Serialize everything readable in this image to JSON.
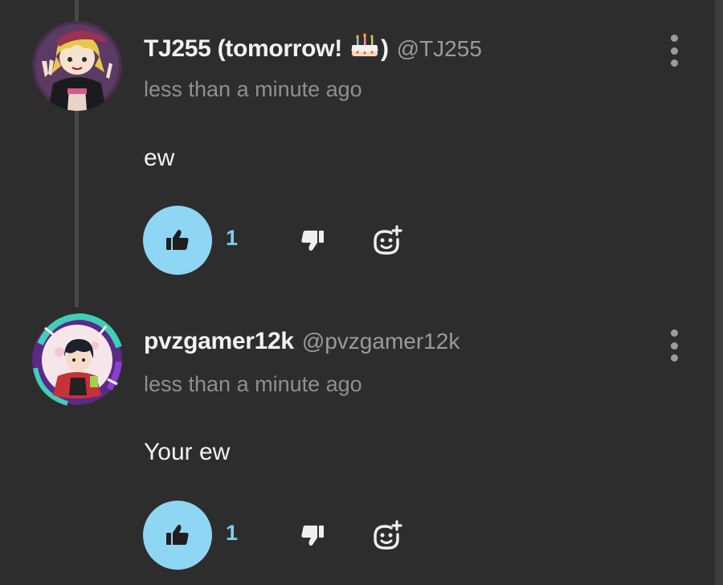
{
  "theme": {
    "background": "#2e2d2d",
    "accent": "#8fd6f4",
    "accent_text": "#7fcdef",
    "muted_text": "#8f8f8f"
  },
  "comments": [
    {
      "display_name_before": "TJ255 (tomorrow! ",
      "badge_icon": "birthday-cake-icon",
      "display_name_after": ")",
      "handle": "@TJ255",
      "timestamp": "less than a minute ago",
      "text": "ew",
      "like_count": "1",
      "avatar_icon": "avatar-anime-girl-cap",
      "liked": true
    },
    {
      "display_name": "pvzgamer12k",
      "handle": "@pvzgamer12k",
      "timestamp": "less than a minute ago",
      "text": "Your ew",
      "like_count": "1",
      "avatar_icon": "avatar-anime-boy-frame",
      "liked": true
    }
  ],
  "icons": {
    "like": "thumbs-up-icon",
    "dislike": "thumbs-down-icon",
    "react": "add-reaction-icon",
    "more": "more-vertical-icon"
  }
}
